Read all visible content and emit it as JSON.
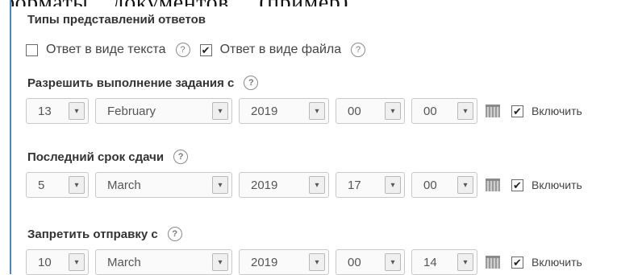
{
  "background_text": "форматы... документов ... (пример)",
  "section_title": "Типы представлений ответов",
  "submission_types": [
    {
      "label": "Ответ в виде текста",
      "checked": false,
      "mark": ""
    },
    {
      "label": "Ответ в виде файла",
      "checked": true,
      "mark": "✔"
    }
  ],
  "help_glyph": "?",
  "arrow_glyph": "▾",
  "fields": [
    {
      "label": "Разрешить выполнение задания с",
      "day": "13",
      "month": "February",
      "year": "2019",
      "hour": "00",
      "minute": "00",
      "enable_label": "Включить",
      "enabled": true,
      "mark": "✔"
    },
    {
      "label": "Последний срок сдачи",
      "day": "5",
      "month": "March",
      "year": "2019",
      "hour": "17",
      "minute": "00",
      "enable_label": "Включить",
      "enabled": true,
      "mark": "✔"
    },
    {
      "label": "Запретить отправку с",
      "day": "10",
      "month": "March",
      "year": "2019",
      "hour": "00",
      "minute": "14",
      "enable_label": "Включить",
      "enabled": true,
      "mark": "✔"
    }
  ]
}
